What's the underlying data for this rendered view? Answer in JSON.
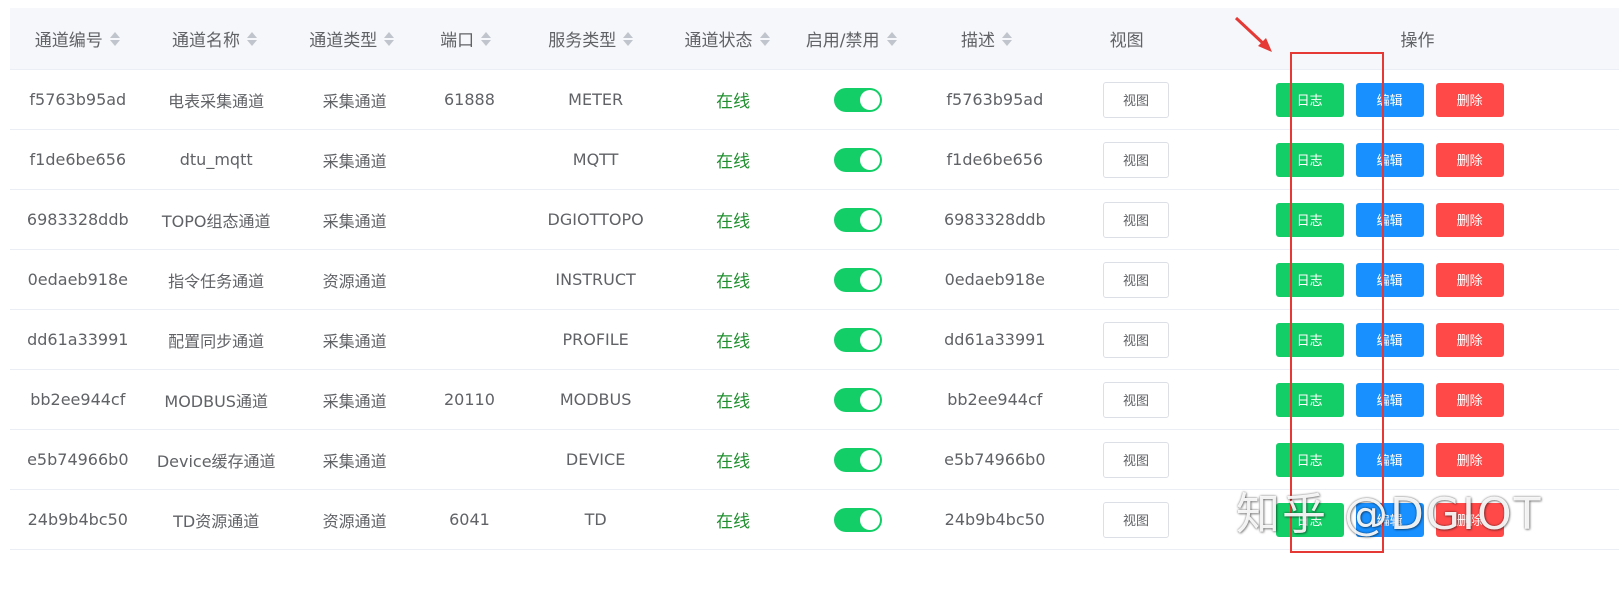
{
  "columns": [
    "通道编号",
    "通道名称",
    "通道类型",
    "端口",
    "服务类型",
    "通道状态",
    "启用/禁用",
    "描述",
    "视图",
    "操作"
  ],
  "rows": [
    {
      "id": "f5763b95ad",
      "name": "电表采集通道",
      "type": "采集通道",
      "port": "61888",
      "service": "METER",
      "status": "在线",
      "enabled": true,
      "desc": "f5763b95ad"
    },
    {
      "id": "f1de6be656",
      "name": "dtu_mqtt",
      "type": "采集通道",
      "port": "",
      "service": "MQTT",
      "status": "在线",
      "enabled": true,
      "desc": "f1de6be656"
    },
    {
      "id": "6983328ddb",
      "name": "TOPO组态通道",
      "type": "采集通道",
      "port": "",
      "service": "DGIOTTOPO",
      "status": "在线",
      "enabled": true,
      "desc": "6983328ddb"
    },
    {
      "id": "0edaeb918e",
      "name": "指令任务通道",
      "type": "资源通道",
      "port": "",
      "service": "INSTRUCT",
      "status": "在线",
      "enabled": true,
      "desc": "0edaeb918e"
    },
    {
      "id": "dd61a33991",
      "name": "配置同步通道",
      "type": "采集通道",
      "port": "",
      "service": "PROFILE",
      "status": "在线",
      "enabled": true,
      "desc": "dd61a33991"
    },
    {
      "id": "bb2ee944cf",
      "name": "MODBUS通道",
      "type": "采集通道",
      "port": "20110",
      "service": "MODBUS",
      "status": "在线",
      "enabled": true,
      "desc": "bb2ee944cf"
    },
    {
      "id": "e5b74966b0",
      "name": "Device缓存通道",
      "type": "采集通道",
      "port": "",
      "service": "DEVICE",
      "status": "在线",
      "enabled": true,
      "desc": "e5b74966b0"
    },
    {
      "id": "24b9b4bc50",
      "name": "TD资源通道",
      "type": "资源通道",
      "port": "6041",
      "service": "TD",
      "status": "在线",
      "enabled": true,
      "desc": "24b9b4bc50"
    }
  ],
  "buttons": {
    "view": "视图",
    "log": "日志",
    "edit": "编辑",
    "delete": "删除"
  },
  "watermark": "知乎 @DGIOT",
  "colors": {
    "switch_on": "#13ce66",
    "log": "#13ce66",
    "edit": "#1890ff",
    "delete": "#ff4949",
    "status_online": "#1f8f2e",
    "highlight": "#e53935"
  }
}
